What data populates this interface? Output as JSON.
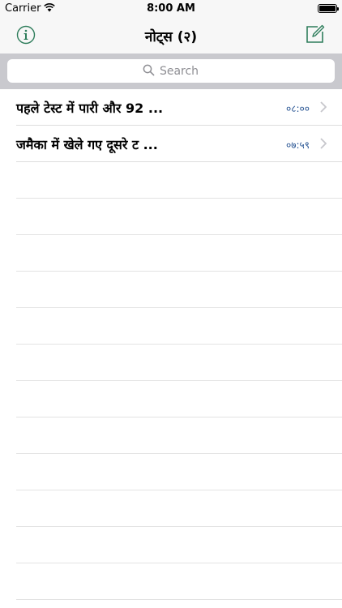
{
  "status_bar": {
    "carrier": "Carrier",
    "time": "8:00 AM",
    "battery_level": 1.0
  },
  "nav_bar": {
    "title": "नोट्स (२)",
    "left_icon": "info-icon",
    "right_icon": "compose-icon",
    "tint_color": "#2e7d5b"
  },
  "search": {
    "placeholder": "Search",
    "value": ""
  },
  "notes": [
    {
      "title": "पहले टेस्ट में पारी और 92 ...",
      "time": "०८:००"
    },
    {
      "title": "जमैका में खेले गए दूसरे ट ...",
      "time": "०७:५९"
    }
  ]
}
